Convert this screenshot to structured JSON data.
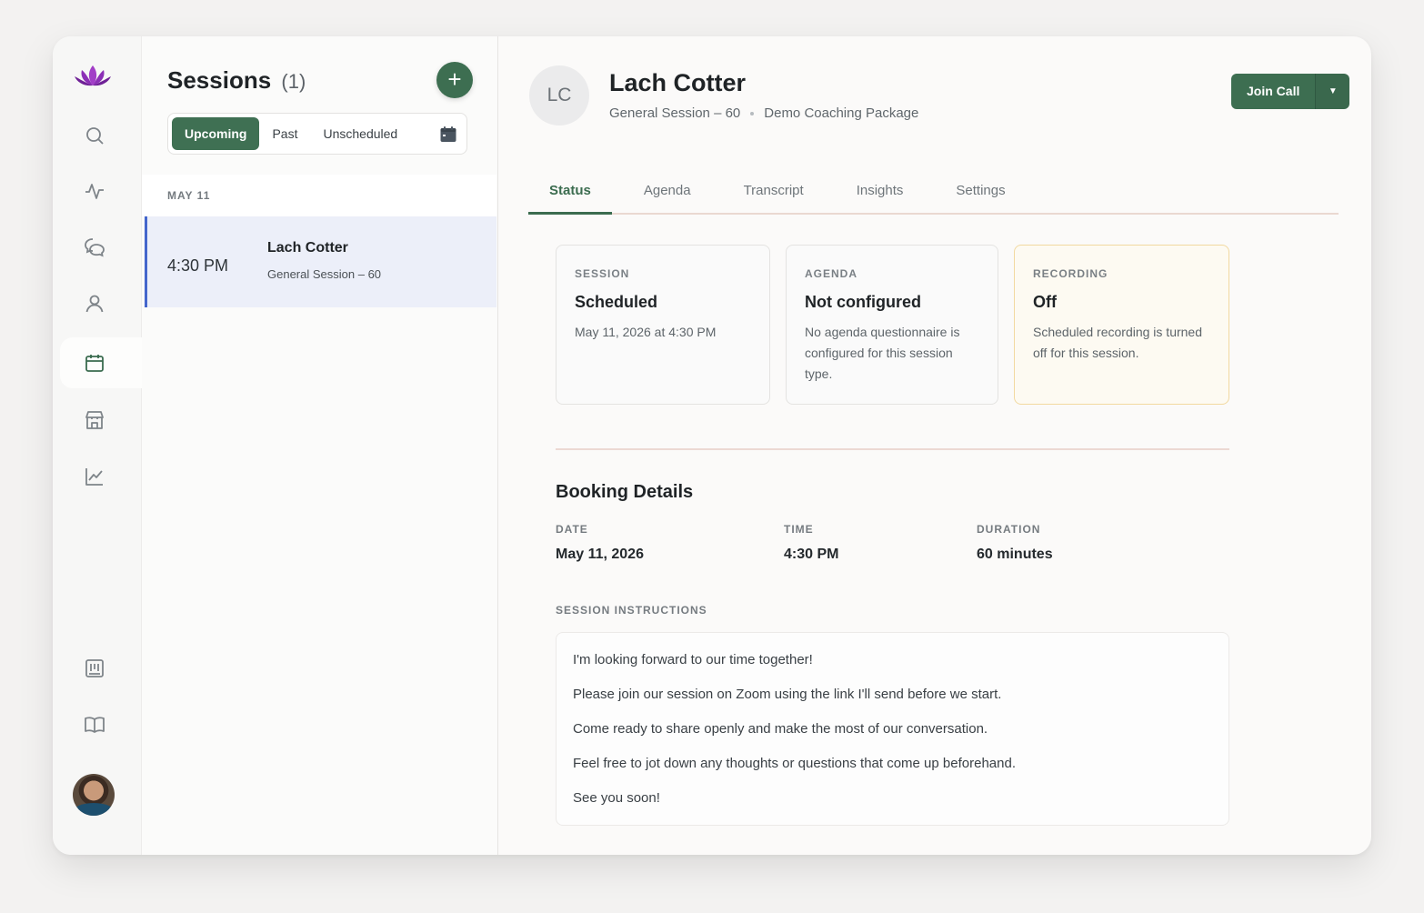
{
  "colors": {
    "accent": "#3d6e51",
    "selected_row": "#eceff9",
    "selected_bar": "#4466cc",
    "warning_border": "#f2d9a0"
  },
  "rail": {
    "icons": [
      "lotus-logo-icon",
      "search-icon",
      "activity-icon",
      "chat-icon",
      "person-icon",
      "calendar-icon",
      "store-icon",
      "chart-icon",
      "board-icon",
      "book-icon"
    ],
    "active": "calendar-icon"
  },
  "sessions": {
    "title": "Sessions",
    "count": "(1)",
    "add_label": "+",
    "filters": [
      "Upcoming",
      "Past",
      "Unscheduled"
    ],
    "active_filter": "Upcoming",
    "date_header": "MAY 11",
    "items": [
      {
        "time": "4:30 PM",
        "name": "Lach Cotter",
        "type": "General Session – 60"
      }
    ]
  },
  "client": {
    "initials": "LC",
    "name": "Lach Cotter",
    "session_type": "General Session – 60",
    "package": "Demo Coaching Package"
  },
  "actions": {
    "join_call": "Join Call",
    "caret": "▼"
  },
  "tabs": [
    {
      "label": "Status",
      "active": true
    },
    {
      "label": "Agenda",
      "active": false
    },
    {
      "label": "Transcript",
      "active": false
    },
    {
      "label": "Insights",
      "active": false
    },
    {
      "label": "Settings",
      "active": false
    }
  ],
  "cards": [
    {
      "label": "SESSION",
      "title": "Scheduled",
      "body": "May 11, 2026 at 4:30 PM"
    },
    {
      "label": "AGENDA",
      "title": "Not configured",
      "body": "No agenda questionnaire is configured for this session type."
    },
    {
      "label": "RECORDING",
      "title": "Off",
      "body": "Scheduled recording is turned off for this session."
    }
  ],
  "booking": {
    "title": "Booking Details",
    "date_label": "DATE",
    "date": "May 11, 2026",
    "time_label": "TIME",
    "time": "4:30 PM",
    "duration_label": "DURATION",
    "duration": "60 minutes"
  },
  "instructions": {
    "label": "SESSION INSTRUCTIONS",
    "lines": [
      "I'm looking forward to our time together!",
      "Please join our session on Zoom using the link I'll send before we start.",
      "Come ready to share openly and make the most of our conversation.",
      "Feel free to jot down any thoughts or questions that come up beforehand.",
      "See you soon!"
    ]
  }
}
